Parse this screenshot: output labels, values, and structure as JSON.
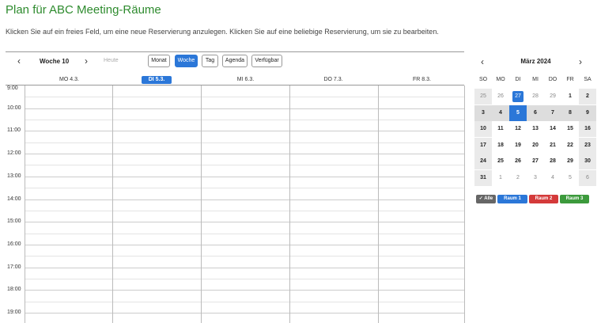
{
  "header": {
    "title": "Plan für ABC Meeting-Räume",
    "subtitle": "Klicken Sie auf ein freies Feld, um eine neue Reservierung anzulegen. Klicken Sie auf eine beliebige Reservierung, um sie zu bearbeiten."
  },
  "toolbar": {
    "prev_icon": "‹",
    "next_icon": "›",
    "week_label": "Woche 10",
    "today_label": "Heute",
    "views": [
      "Monat",
      "Woche",
      "Tag",
      "Agenda",
      "Verfügbar"
    ],
    "active_view": "Woche"
  },
  "calendar": {
    "days": [
      "MO 4.3.",
      "DI 5.3.",
      "MI 6.3.",
      "DO 7.3.",
      "FR 8.3."
    ],
    "today_index": 1,
    "hours": [
      "9:00",
      "10:00",
      "11:00",
      "12:00",
      "13:00",
      "14:00",
      "15:00",
      "16:00",
      "17:00",
      "18:00",
      "19:00"
    ]
  },
  "mini_calendar": {
    "month_label": "März 2024",
    "prev_icon": "‹",
    "next_icon": "›",
    "weekday_headers": [
      "SO",
      "MO",
      "DI",
      "MI",
      "DO",
      "FR",
      "SA"
    ],
    "weeks": [
      [
        "25",
        "26",
        "27",
        "28",
        "29",
        "1",
        "2"
      ],
      [
        "3",
        "4",
        "5",
        "6",
        "7",
        "8",
        "9"
      ],
      [
        "10",
        "11",
        "12",
        "13",
        "14",
        "15",
        "16"
      ],
      [
        "17",
        "18",
        "19",
        "20",
        "21",
        "22",
        "23"
      ],
      [
        "24",
        "25",
        "26",
        "27",
        "28",
        "29",
        "30"
      ],
      [
        "31",
        "1",
        "2",
        "3",
        "4",
        "5",
        "6"
      ]
    ]
  },
  "legend": {
    "items": [
      {
        "label": "Alle",
        "color": "#666666",
        "icon": "check-icon"
      },
      {
        "label": "Raum 1",
        "color": "#2b77d8"
      },
      {
        "label": "Raum 2",
        "color": "#d43a3a"
      },
      {
        "label": "Raum 3",
        "color": "#3c9a3c"
      }
    ]
  }
}
